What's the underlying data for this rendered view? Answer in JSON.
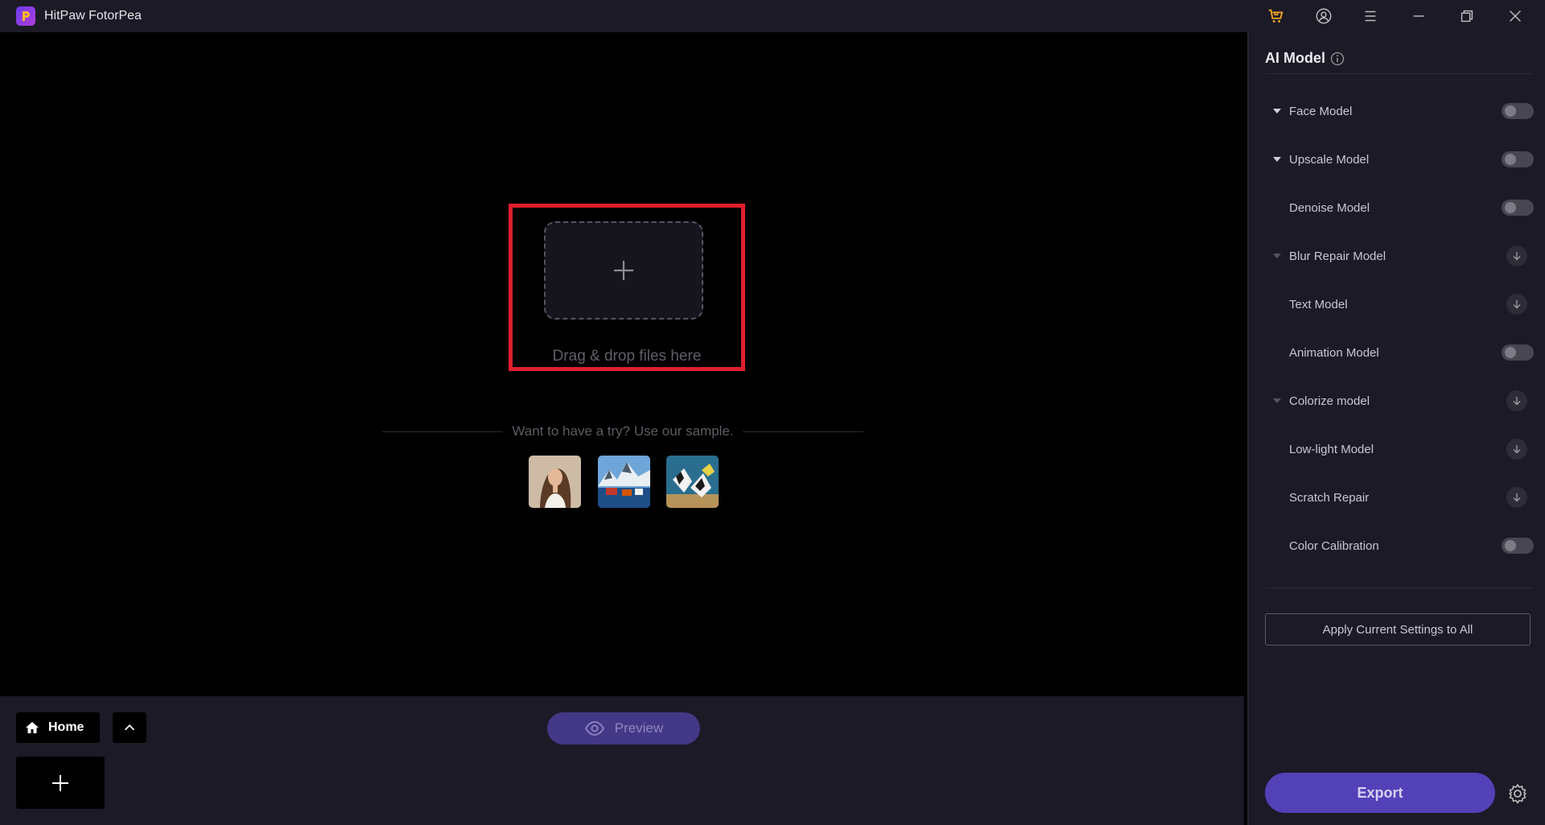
{
  "app": {
    "title": "HitPaw FotorPea"
  },
  "titlebar": {
    "icons": [
      "shop-cart-icon",
      "user-account-icon",
      "menu-icon",
      "minimize-icon",
      "restore-icon",
      "close-icon"
    ]
  },
  "canvas": {
    "drop_label": "Drag & drop files here",
    "sample_prompt": "Want to have a try? Use our sample.",
    "samples": [
      "sample-portrait",
      "sample-landscape",
      "sample-fish"
    ]
  },
  "bottombar": {
    "home_label": "Home",
    "preview_label": "Preview"
  },
  "panel": {
    "title": "AI Model",
    "models": [
      {
        "label": "Face Model",
        "caret": "down",
        "control": "toggle",
        "on": false
      },
      {
        "label": "Upscale Model",
        "caret": "down",
        "control": "toggle",
        "on": false
      },
      {
        "label": "Denoise Model",
        "caret": "none",
        "control": "toggle",
        "on": false
      },
      {
        "label": "Blur Repair Model",
        "caret": "down-dim",
        "control": "download"
      },
      {
        "label": "Text Model",
        "caret": "none",
        "control": "download"
      },
      {
        "label": "Animation Model",
        "caret": "none",
        "control": "toggle",
        "on": false
      },
      {
        "label": "Colorize model",
        "caret": "down-dim",
        "control": "download"
      },
      {
        "label": "Low-light Model",
        "caret": "none",
        "control": "download"
      },
      {
        "label": "Scratch Repair",
        "caret": "none",
        "control": "download"
      },
      {
        "label": "Color Calibration",
        "caret": "none",
        "control": "toggle",
        "on": false
      }
    ],
    "apply_label": "Apply Current Settings to All",
    "export_label": "Export"
  },
  "colors": {
    "accent": "#5341b8",
    "highlight": "#e01e2d",
    "panel_bg": "#1b1a26"
  }
}
